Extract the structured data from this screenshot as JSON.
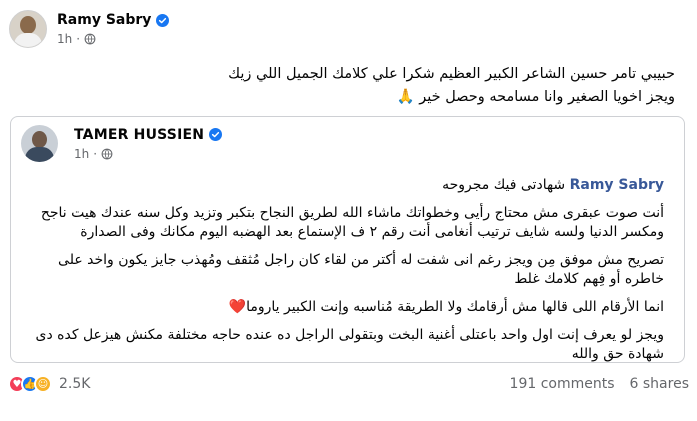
{
  "post": {
    "author": "Ramy Sabry",
    "time": "1h",
    "dot": "·",
    "text_lines": [
      "حبيبي تامر حسين الشاعر الكبير العظيم شكرا علي كلامك الجميل اللي زيك",
      "ويجز اخويا الصغير وانا مسامحه وحصل خير 🙏"
    ]
  },
  "shared": {
    "author": "TAMER HUSSIEN",
    "time": "1h",
    "dot": "·",
    "mention": "Ramy Sabry",
    "mention_suffix": " شهادتى فيك مجروحه",
    "paragraph1": "أنت صوت عبقرى مش محتاج رأيى وخطواتك ماشاء الله لطريق النجاح بتكبر وتزيد وكل سنه عندك هيت ناجح ومكسر الدنيا ولسه شايف ترتيب أنغامى أنت رقم ٢ ف الإستماع بعد الهضبه اليوم مكانك وفى الصدارة",
    "paragraph2": "تصريح مش موفق مِن ويجز رغم انى شفت له أكتر من لقاء كان راجل مُثقف ومُهذب جايز يكون واخد على خاطره أو فِهم كلامك غلط",
    "paragraph3": "انما الأرقام اللى قالها مش أرقامك ولا الطريقة مُناسبه وإنت الكبير ياروما❤️",
    "paragraph4": "ويجز لو يعرف إنت اول واحد باعتلى أغنية البخت وبتقولى الراجل ده عنده حاجه مختلفة مكنش هيزعل كده دى شهادة حق والله"
  },
  "footer": {
    "reaction_count": "2.5K",
    "comments": "191 comments",
    "shares": "6 shares"
  },
  "colors": {
    "verified": "#1877f2",
    "mention": "#385898",
    "secondary_text": "#65676b",
    "border": "#ced0d4"
  },
  "icons": [
    "verified-badge-icon",
    "globe-icon",
    "love-reaction-icon",
    "like-reaction-icon",
    "care-reaction-icon"
  ]
}
